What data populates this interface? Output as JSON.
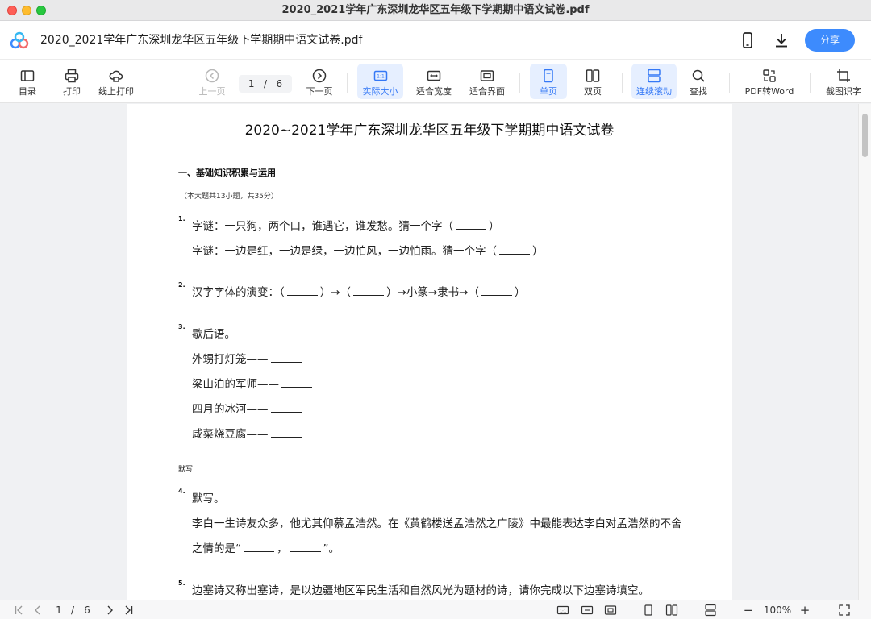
{
  "window": {
    "title": "2020_2021学年广东深圳龙华区五年级下学期期中语文试卷.pdf"
  },
  "header": {
    "doc_name": "2020_2021学年广东深圳龙华区五年级下学期期中语文试卷.pdf",
    "share_label": "分享",
    "icons": [
      "app-logo-icon",
      "phone-icon",
      "download-icon"
    ],
    "accent_color": "#3d8bfd"
  },
  "toolbar": {
    "toc": "目录",
    "print": "打印",
    "online_print": "线上打印",
    "prev_page": "上一页",
    "current_page": "1",
    "page_sep": "/",
    "total_pages": "6",
    "next_page": "下一页",
    "actual_size": "实际大小",
    "fit_width": "适合宽度",
    "fit_page": "适合界面",
    "single_page": "单页",
    "double_page": "双页",
    "continuous_scroll": "连续滚动",
    "find": "查找",
    "pdf_to_word": "PDF转Word",
    "ocr": "截图识字",
    "active_color": "#3478f6"
  },
  "document": {
    "title": "2020~2021学年广东深圳龙华区五年级下学期期中语文试卷",
    "section1": "一、基础知识积累与运用",
    "section1_note": "（本大题共13小题，共35分）",
    "q1_num": "1.",
    "q1_line1_a": "字谜：一只狗，两个口，谁遇它，谁发愁。猜一个字（",
    "q1_line1_b": "）",
    "q1_line2_a": "字谜：一边是红，一边是绿，一边怕风，一边怕雨。猜一个字（",
    "q1_line2_b": "）",
    "q2_num": "2.",
    "q2_a": "汉字字体的演变：（",
    "q2_b": "）→（",
    "q2_c": "）→小篆→隶书→（",
    "q2_d": "）",
    "q3_num": "3.",
    "q3_head": "歇后语。",
    "q3_items": [
      "外甥打灯笼——",
      "梁山泊的军师——",
      "四月的冰河——",
      "咸菜烧豆腐——"
    ],
    "sub_head": "默写",
    "q4_num": "4.",
    "q4_head": "默写。",
    "q4_line1": "李白一生诗友众多，他尤其仰慕孟浩然。在《黄鹤楼送孟浩然之广陵》中最能表达李白对孟浩然的不舍",
    "q4_line2_a": "之情的是“",
    "q4_line2_b": "，",
    "q4_line2_c": "”。",
    "q5_num": "5.",
    "q5_line1": "边塞诗又称出塞诗，是以边疆地区军民生活和自然风光为题材的诗，请你完成以下边塞诗填空。"
  },
  "statusbar": {
    "current_page": "1",
    "page_sep": "/",
    "total_pages": "6",
    "zoom": "100%",
    "minus": "−",
    "plus": "+"
  }
}
